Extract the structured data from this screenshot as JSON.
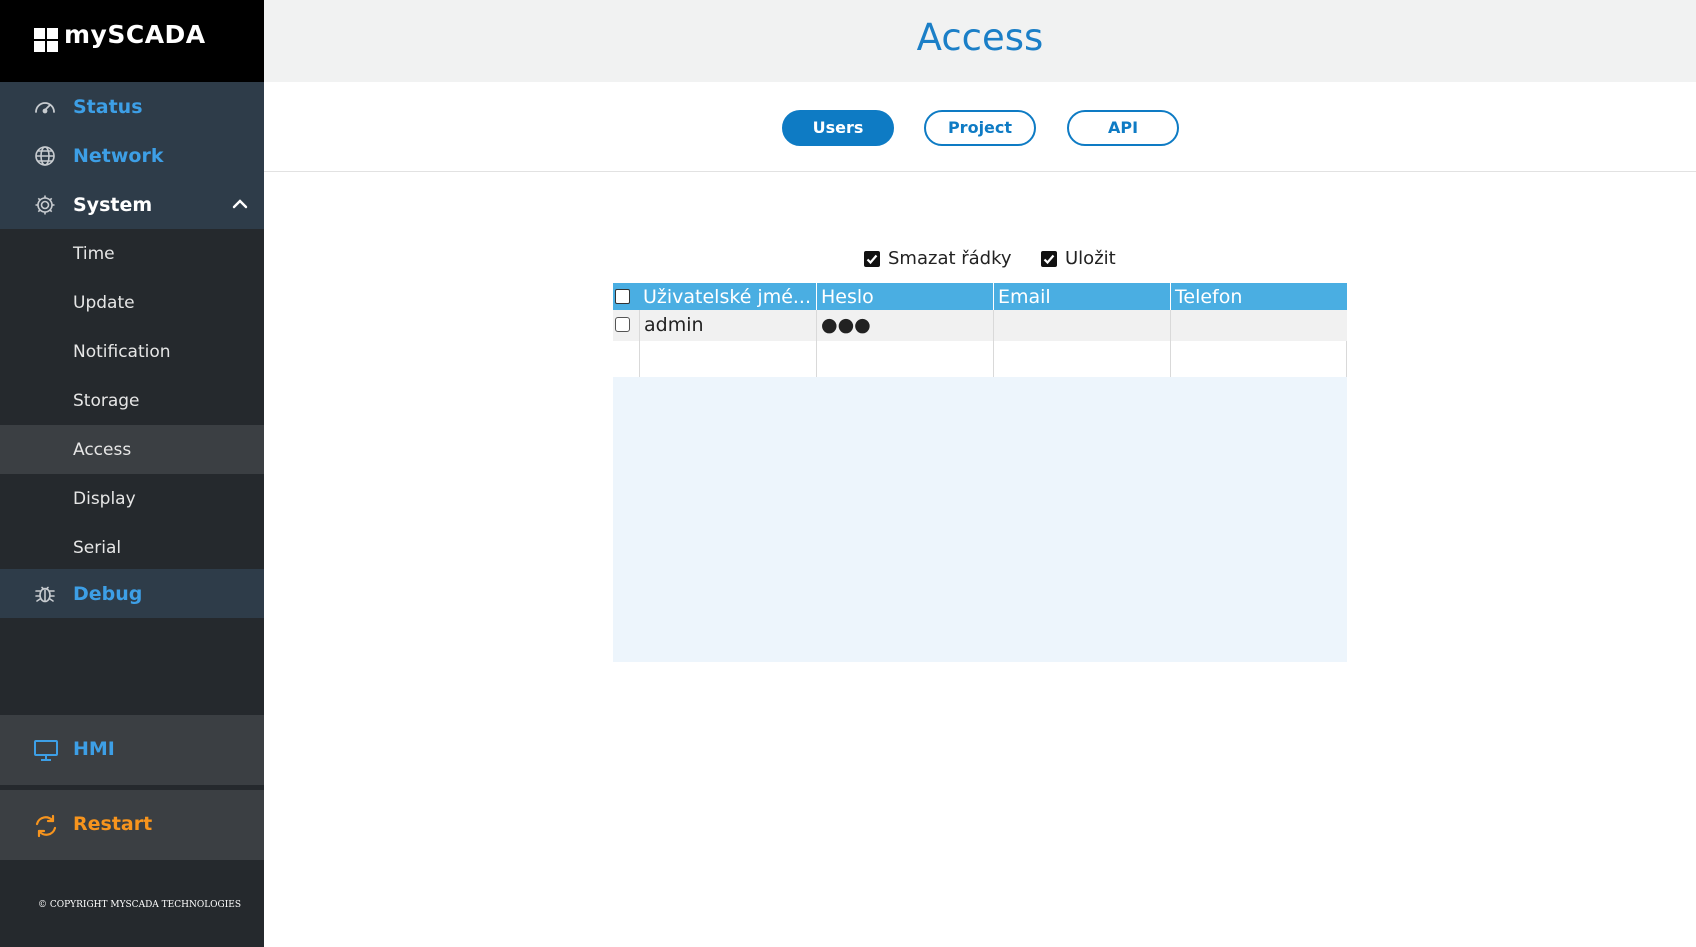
{
  "brand": {
    "logo_text": "mySCADA"
  },
  "sidebar": {
    "items": [
      {
        "label": "Status",
        "icon": "gauge-icon"
      },
      {
        "label": "Network",
        "icon": "globe-icon"
      },
      {
        "label": "System",
        "icon": "gear-icon",
        "expanded": true
      }
    ],
    "system_sub": [
      "Time",
      "Update",
      "Notification",
      "Storage",
      "Access",
      "Display",
      "Serial"
    ],
    "active_sub": "Access",
    "debug": {
      "label": "Debug",
      "icon": "bug-icon"
    },
    "hmi": {
      "label": "HMI",
      "icon": "monitor-icon"
    },
    "restart": {
      "label": "Restart",
      "icon": "refresh-icon"
    },
    "copyright": "© COPYRIGHT MYSCADA TECHNOLOGIES"
  },
  "header": {
    "title": "Access"
  },
  "tabs": [
    {
      "label": "Users",
      "active": true
    },
    {
      "label": "Project",
      "active": false
    },
    {
      "label": "API",
      "active": false
    }
  ],
  "options": {
    "delete_rows": {
      "label": "Smazat řádky",
      "checked": true
    },
    "save": {
      "label": "Uložit",
      "checked": true
    }
  },
  "table": {
    "columns": [
      "Uživatelské jmé...",
      "Heslo",
      "Email",
      "Telefon"
    ],
    "rows": [
      {
        "username": "admin",
        "password": "●●●",
        "email": "",
        "phone": ""
      }
    ]
  },
  "colors": {
    "accent": "#0e7bc4",
    "sidebar_bg": "#25292d",
    "nav_link": "#3d9fe6",
    "restart": "#f7941d",
    "table_header": "#4aaee2"
  }
}
